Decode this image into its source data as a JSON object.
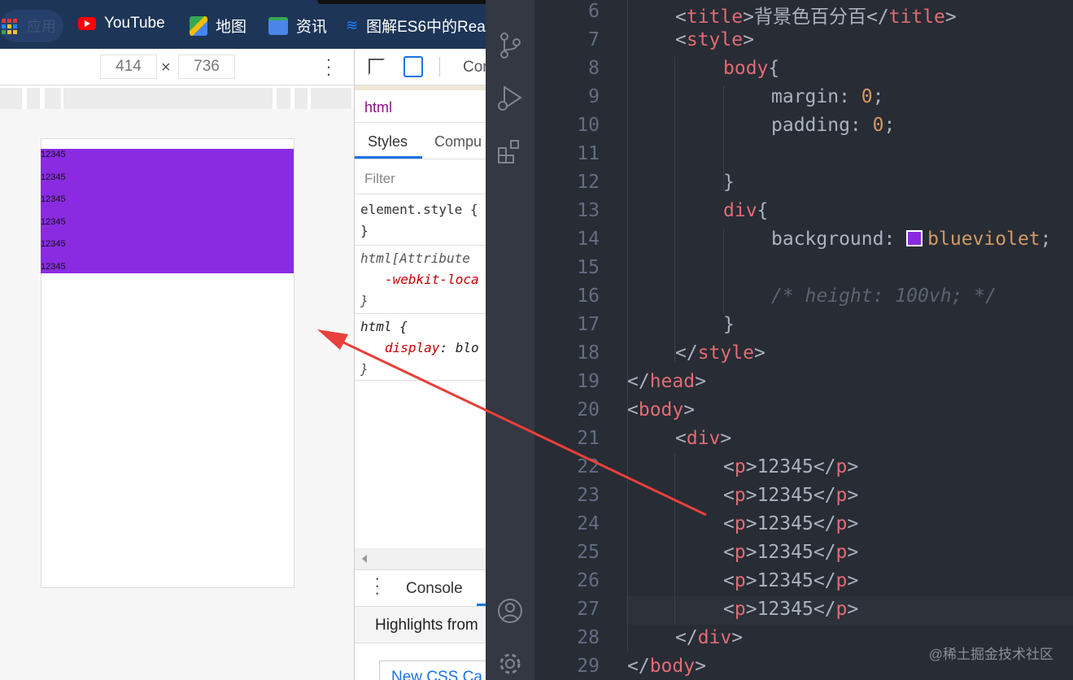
{
  "bookmarks": {
    "apps_label": "应用",
    "items": [
      {
        "label": "YouTube"
      },
      {
        "label": "地图"
      },
      {
        "label": "资讯"
      },
      {
        "label": "图解ES6中的Rea"
      }
    ]
  },
  "device_toolbar": {
    "width": "414",
    "height": "736",
    "times": "×"
  },
  "preview": {
    "paragraphs": [
      "12345",
      "12345",
      "12345",
      "12345",
      "12345",
      "12345"
    ],
    "background": "#8a2be2"
  },
  "devtools": {
    "top_tab": "Cor",
    "breadcrumb": "html",
    "tabs": [
      "Styles",
      "Compu"
    ],
    "filter_placeholder": "Filter",
    "rules": [
      {
        "selector": "element.style {",
        "close": "}"
      },
      {
        "selector": "html[Attribute",
        "prop": "-webkit-loca",
        "close": "}"
      },
      {
        "selector": "html {",
        "prop": "display",
        "value": "blo",
        "close": "}"
      }
    ],
    "drawer_tab": "Console",
    "highlights": "Highlights from",
    "link": "New CSS Ca"
  },
  "editor": {
    "accent": "#8a2be2",
    "lines": [
      {
        "n": "6",
        "indent": 1,
        "tokens": [
          [
            "<",
            "punc"
          ],
          [
            "title",
            "tag"
          ],
          [
            ">",
            "punc"
          ],
          [
            "背景色百分百",
            "txt"
          ],
          [
            "</",
            "punc"
          ],
          [
            "title",
            "tag"
          ],
          [
            ">",
            "punc"
          ]
        ]
      },
      {
        "n": "7",
        "indent": 1,
        "tokens": [
          [
            "<",
            "punc"
          ],
          [
            "style",
            "tag"
          ],
          [
            ">",
            "punc"
          ]
        ]
      },
      {
        "n": "8",
        "indent": 2,
        "tokens": [
          [
            "body",
            "tag"
          ],
          [
            "{",
            "punc"
          ]
        ]
      },
      {
        "n": "9",
        "indent": 3,
        "tokens": [
          [
            "margin: ",
            "txt"
          ],
          [
            "0",
            "num"
          ],
          [
            ";",
            "punc"
          ]
        ]
      },
      {
        "n": "10",
        "indent": 3,
        "tokens": [
          [
            "padding: ",
            "txt"
          ],
          [
            "0",
            "num"
          ],
          [
            ";",
            "punc"
          ]
        ]
      },
      {
        "n": "11",
        "indent": 0,
        "tokens": []
      },
      {
        "n": "12",
        "indent": 2,
        "tokens": [
          [
            "}",
            "punc"
          ]
        ]
      },
      {
        "n": "13",
        "indent": 2,
        "tokens": [
          [
            "div",
            "tag"
          ],
          [
            "{",
            "punc"
          ]
        ]
      },
      {
        "n": "14",
        "indent": 3,
        "tokens": [
          [
            "background: ",
            "txt"
          ],
          [
            "SWATCH",
            "swatch"
          ],
          [
            "blueviolet",
            "val"
          ],
          [
            ";",
            "punc"
          ]
        ]
      },
      {
        "n": "15",
        "indent": 0,
        "tokens": []
      },
      {
        "n": "16",
        "indent": 3,
        "tokens": [
          [
            "/* height: 100vh; */",
            "com"
          ]
        ]
      },
      {
        "n": "17",
        "indent": 2,
        "tokens": [
          [
            "}",
            "punc"
          ]
        ]
      },
      {
        "n": "18",
        "indent": 1,
        "tokens": [
          [
            "</",
            "punc"
          ],
          [
            "style",
            "tag"
          ],
          [
            ">",
            "punc"
          ]
        ]
      },
      {
        "n": "19",
        "indent": 0,
        "tokens": [
          [
            "</",
            "punc"
          ],
          [
            "head",
            "tag"
          ],
          [
            ">",
            "punc"
          ]
        ]
      },
      {
        "n": "20",
        "indent": 0,
        "tokens": [
          [
            "<",
            "punc"
          ],
          [
            "body",
            "tag"
          ],
          [
            ">",
            "punc"
          ]
        ]
      },
      {
        "n": "21",
        "indent": 1,
        "tokens": [
          [
            "<",
            "punc"
          ],
          [
            "div",
            "tag"
          ],
          [
            ">",
            "punc"
          ]
        ]
      },
      {
        "n": "22",
        "indent": 2,
        "tokens": [
          [
            "<",
            "punc"
          ],
          [
            "p",
            "tag"
          ],
          [
            ">",
            "punc"
          ],
          [
            "12345",
            "txt"
          ],
          [
            "</",
            "punc"
          ],
          [
            "p",
            "tag"
          ],
          [
            ">",
            "punc"
          ]
        ]
      },
      {
        "n": "23",
        "indent": 2,
        "tokens": [
          [
            "<",
            "punc"
          ],
          [
            "p",
            "tag"
          ],
          [
            ">",
            "punc"
          ],
          [
            "12345",
            "txt"
          ],
          [
            "</",
            "punc"
          ],
          [
            "p",
            "tag"
          ],
          [
            ">",
            "punc"
          ]
        ]
      },
      {
        "n": "24",
        "indent": 2,
        "tokens": [
          [
            "<",
            "punc"
          ],
          [
            "p",
            "tag"
          ],
          [
            ">",
            "punc"
          ],
          [
            "12345",
            "txt"
          ],
          [
            "</",
            "punc"
          ],
          [
            "p",
            "tag"
          ],
          [
            ">",
            "punc"
          ]
        ]
      },
      {
        "n": "25",
        "indent": 2,
        "tokens": [
          [
            "<",
            "punc"
          ],
          [
            "p",
            "tag"
          ],
          [
            ">",
            "punc"
          ],
          [
            "12345",
            "txt"
          ],
          [
            "</",
            "punc"
          ],
          [
            "p",
            "tag"
          ],
          [
            ">",
            "punc"
          ]
        ]
      },
      {
        "n": "26",
        "indent": 2,
        "tokens": [
          [
            "<",
            "punc"
          ],
          [
            "p",
            "tag"
          ],
          [
            ">",
            "punc"
          ],
          [
            "12345",
            "txt"
          ],
          [
            "</",
            "punc"
          ],
          [
            "p",
            "tag"
          ],
          [
            ">",
            "punc"
          ]
        ]
      },
      {
        "n": "27",
        "indent": 2,
        "tokens": [
          [
            "<",
            "punc"
          ],
          [
            "p",
            "tag"
          ],
          [
            ">",
            "punc"
          ],
          [
            "12345",
            "txt"
          ],
          [
            "</",
            "punc"
          ],
          [
            "p",
            "tag"
          ],
          [
            ">",
            "punc"
          ]
        ]
      },
      {
        "n": "28",
        "indent": 1,
        "tokens": [
          [
            "</",
            "punc"
          ],
          [
            "div",
            "tag"
          ],
          [
            ">",
            "punc"
          ]
        ]
      },
      {
        "n": "29",
        "indent": 0,
        "tokens": [
          [
            "</",
            "punc"
          ],
          [
            "body",
            "tag"
          ],
          [
            ">",
            "punc"
          ]
        ]
      }
    ]
  },
  "watermark": "@稀土掘金技术社区"
}
